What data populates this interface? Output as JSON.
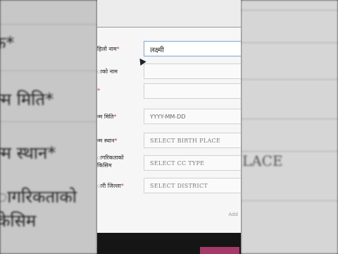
{
  "left_panel": {
    "texts": [
      "क*",
      "न्म मिति*",
      "न्म स्थान*",
      "ागरिकताको",
      "केसिम"
    ]
  },
  "right_panel": {
    "text": "LACE"
  },
  "form": {
    "fields": [
      {
        "label": "हिलो नाम",
        "required": true,
        "value": "लक्ष्मी",
        "placeholder": ""
      },
      {
        "label": "ाको नाम",
        "required": false,
        "value": "",
        "placeholder": ""
      },
      {
        "label": "",
        "required": true,
        "value": "",
        "placeholder": ""
      },
      {
        "label": "न्म मिति",
        "required": true,
        "value": "",
        "placeholder": "YYYY-MM-DD"
      },
      {
        "label": "न्म स्थान",
        "required": true,
        "value": "",
        "placeholder": "SELECT BIRTH PLACE"
      },
      {
        "label": "ागरिकताको\nकिसिम",
        "required": false,
        "value": "",
        "placeholder": "SELECT CC TYPE"
      },
      {
        "label": "ारी जिल्ला",
        "required": true,
        "value": "",
        "placeholder": "SELECT DISTRICT"
      }
    ],
    "add_link": "Add"
  },
  "colors": {
    "required_star": "#cc3333",
    "active_border": "#7aa7d6"
  }
}
